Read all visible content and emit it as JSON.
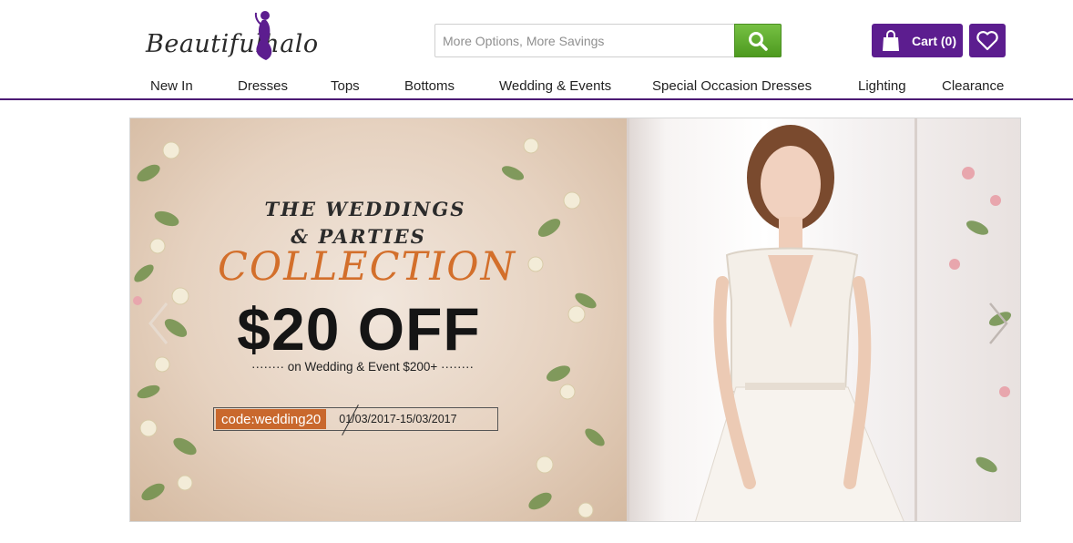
{
  "header": {
    "logo_text": "Beautifulhalo",
    "search_placeholder": "More Options, More Savings",
    "search_icon": "search-icon",
    "cart_label": "Cart (0)",
    "cart_icon": "shopping-bag-icon",
    "wishlist_icon": "heart-icon"
  },
  "colors": {
    "brand_purple": "#5c1d8f",
    "search_green": "#5ca62c",
    "accent_orange": "#d36f2b"
  },
  "nav": {
    "items": [
      "New In",
      "Dresses",
      "Tops",
      "Bottoms",
      "Wedding & Events",
      "Special Occasion Dresses",
      "Lighting",
      "Clearance"
    ]
  },
  "banner": {
    "line1": "THE WEDDINGS",
    "line2": "& PARTIES",
    "line3": "COLLECTION",
    "discount": "$20 OFF",
    "subtitle": "········ on Wedding & Event $200+ ········",
    "code": "code:wedding20",
    "dates": "01/03/2017-15/03/2017",
    "prev_icon": "chevron-left-icon",
    "next_icon": "chevron-right-icon"
  }
}
